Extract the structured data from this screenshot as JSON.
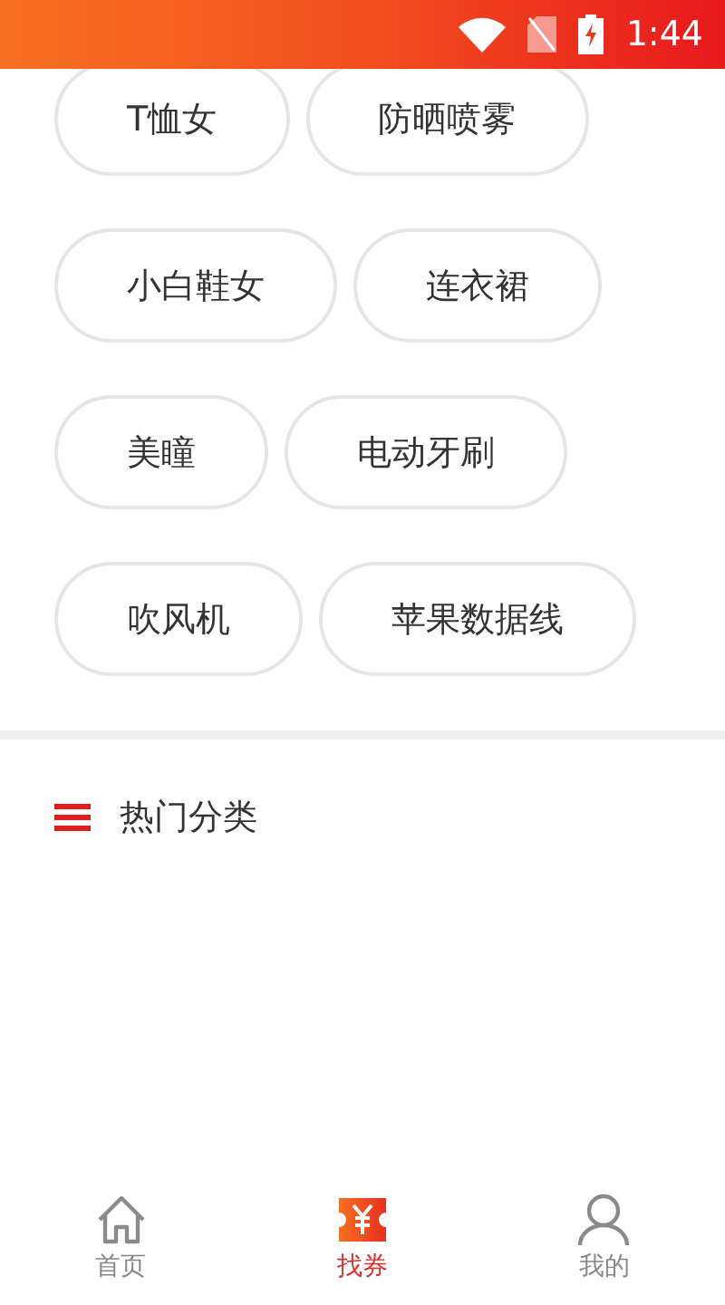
{
  "status_bar": {
    "time": "1:44"
  },
  "tags": [
    {
      "label": "T恤女"
    },
    {
      "label": "防晒喷雾"
    },
    {
      "label": "小白鞋女"
    },
    {
      "label": "连衣裙"
    },
    {
      "label": "美瞳"
    },
    {
      "label": "电动牙刷"
    },
    {
      "label": "吹风机"
    },
    {
      "label": "苹果数据线"
    }
  ],
  "section": {
    "title": "热门分类"
  },
  "tab_bar": [
    {
      "kind": "home",
      "label": "首页",
      "selected": false
    },
    {
      "kind": "coupon",
      "label": "找券",
      "selected": true
    },
    {
      "kind": "profile",
      "label": "我的",
      "selected": false
    }
  ]
}
